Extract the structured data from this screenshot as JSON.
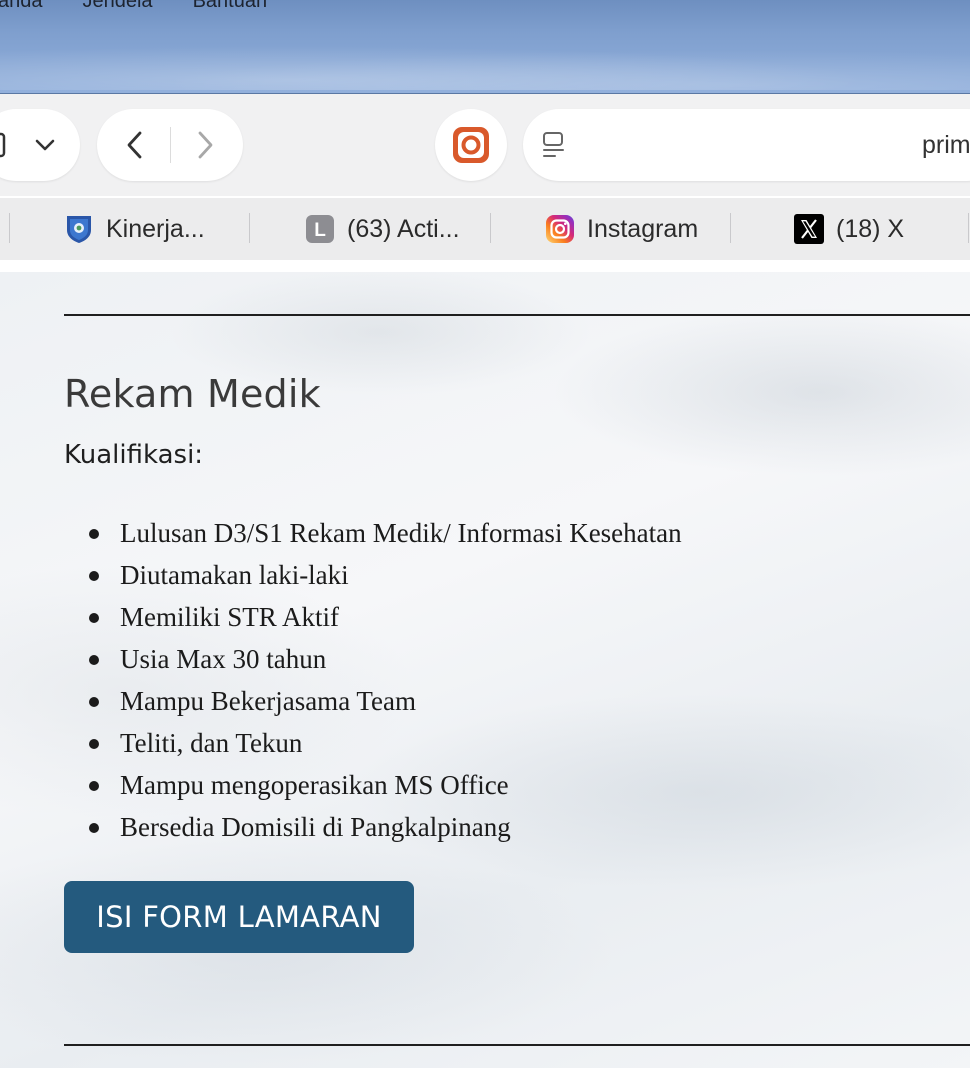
{
  "menubar": {
    "items": [
      "Tanda",
      "Jendela",
      "Bantuan"
    ]
  },
  "toolbar": {
    "url_text": "prim",
    "icons": {
      "sidebar": "sidebar-icon",
      "dropdown": "chevron-down-icon",
      "back": "chevron-left-icon",
      "forward": "chevron-right-icon",
      "extension": "extension-icon",
      "reader": "reader-icon"
    }
  },
  "bookmarks": {
    "items": [
      {
        "label": "Kinerja...",
        "icon": "shield-favicon"
      },
      {
        "label": "(63) Acti...",
        "icon": "letter-l-favicon",
        "badge": "L"
      },
      {
        "label": "Instagram",
        "icon": "instagram-icon"
      },
      {
        "label": "(18) X",
        "icon": "x-icon"
      }
    ]
  },
  "content": {
    "job_title": "Rekam Medik",
    "qualification_label": "Kualifikasi:",
    "qualifications": [
      "Lulusan D3/S1 Rekam Medik/ Informasi Kesehatan",
      "Diutamakan laki-laki",
      "Memiliki STR Aktif",
      "Usia Max 30 tahun",
      "Mampu Bekerjasama Team",
      "Teliti, dan Tekun",
      "Mampu mengoperasikan MS Office",
      "Bersedia Domisili di Pangkalpinang"
    ],
    "apply_button_label": "ISI FORM LAMARAN"
  },
  "colors": {
    "button_bg": "#245a7e",
    "button_text": "#ffffff",
    "extension_accent": "#d9592b"
  }
}
